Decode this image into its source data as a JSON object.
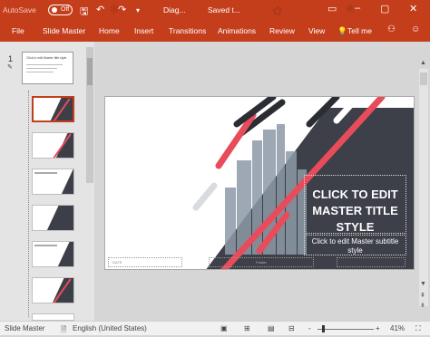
{
  "titlebar": {
    "autosave_label": "AutoSave",
    "autosave_state": "Off",
    "doc_title": "Diag...",
    "saved_text": "Saved t...",
    "icons": [
      "save-icon",
      "undo-icon",
      "redo-icon",
      "customize-icon",
      "ribbon-display-icon",
      "minimize-icon",
      "maximize-icon",
      "close-icon"
    ],
    "accent": "#c43e1c"
  },
  "ribbon": {
    "tabs": [
      "File",
      "Slide Master",
      "Home",
      "Insert",
      "Transitions",
      "Animations",
      "Review",
      "View"
    ],
    "tell_me": "Tell me"
  },
  "thumbnails": {
    "slide_number": "1",
    "master_title": "Click to edit Master title style",
    "count": 7
  },
  "slide": {
    "title": "CLICK TO EDIT MASTER TITLE STYLE",
    "subtitle": "Click to edit Master subtitle style",
    "date_placeholder": "DATE",
    "footer_placeholder": "Footer",
    "colors": {
      "dark": "#3d3f49",
      "red": "#e84c5b"
    }
  },
  "status": {
    "view": "Slide Master",
    "language": "English (United States)",
    "zoom": "41%",
    "zoom_in": "+",
    "zoom_out": "-"
  }
}
